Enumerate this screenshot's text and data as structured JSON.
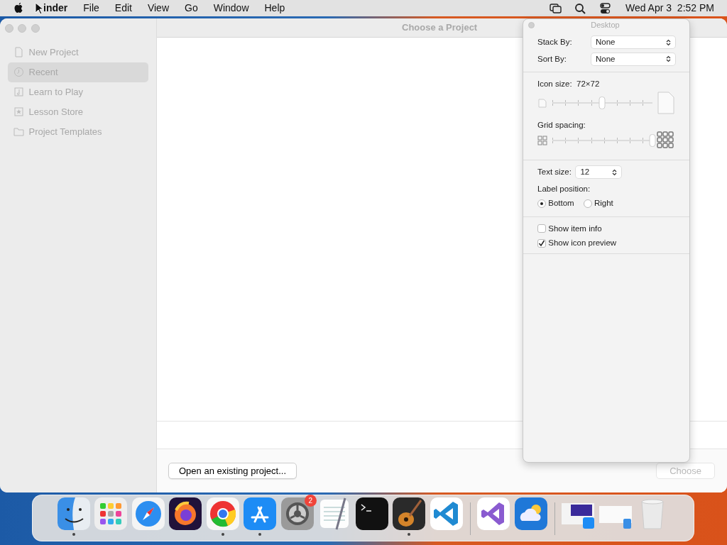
{
  "menubar": {
    "app_menu": "inder",
    "items": [
      {
        "label": "File"
      },
      {
        "label": "Edit"
      },
      {
        "label": "View"
      },
      {
        "label": "Go"
      },
      {
        "label": "Window"
      },
      {
        "label": "Help"
      }
    ],
    "clock": "Wed Apr 3  2:52 PM"
  },
  "window": {
    "title": "Choose a Project",
    "sidebar": [
      {
        "label": "New Project",
        "kind": "document",
        "selected": false
      },
      {
        "label": "Recent",
        "kind": "clock",
        "selected": true
      },
      {
        "label": "Learn to Play",
        "kind": "music",
        "selected": false
      },
      {
        "label": "Lesson Store",
        "kind": "star",
        "selected": false
      },
      {
        "label": "Project Templates",
        "kind": "folder",
        "selected": false
      }
    ],
    "buttons": [
      {
        "label": "Open an existing project...",
        "disabled": false
      },
      {
        "label": "Choose",
        "disabled": true
      }
    ]
  },
  "desktop_panel": {
    "title": "Desktop",
    "stack_by": {
      "label": "Stack By:",
      "value": "None"
    },
    "sort_by": {
      "label": "Sort By:",
      "value": "None"
    },
    "icon_size": {
      "label": "Icon size:",
      "value": "72×72",
      "level": 0.5
    },
    "grid_spacing": {
      "label": "Grid spacing:",
      "level": 1
    },
    "text_size": {
      "label": "Text size:",
      "value": "12"
    },
    "label_position": {
      "label": "Label position:",
      "options": [
        {
          "label": "Bottom",
          "selected": true
        },
        {
          "label": "Right",
          "selected": false
        }
      ]
    },
    "checkboxes": [
      {
        "label": "Show item info",
        "checked": false
      },
      {
        "label": "Show icon preview",
        "checked": true
      }
    ]
  },
  "dock": {
    "groups": [
      [
        {
          "kind": "finder",
          "running": true
        },
        {
          "kind": "launchpad",
          "running": false
        },
        {
          "kind": "safari",
          "running": false
        },
        {
          "kind": "firefox",
          "running": false
        },
        {
          "kind": "chrome",
          "running": true
        },
        {
          "kind": "appstore",
          "running": true
        },
        {
          "kind": "settings",
          "running": false,
          "badge": "2"
        },
        {
          "kind": "textedit",
          "running": false
        },
        {
          "kind": "terminal",
          "running": false
        },
        {
          "kind": "guitar",
          "running": true
        },
        {
          "kind": "vscode",
          "running": false
        }
      ],
      [
        {
          "kind": "vstudio",
          "running": false
        },
        {
          "kind": "weather",
          "running": false
        }
      ],
      [
        {
          "kind": "screenshot",
          "running": false
        },
        {
          "kind": "window",
          "running": false
        },
        {
          "kind": "trash",
          "running": false
        }
      ]
    ]
  }
}
